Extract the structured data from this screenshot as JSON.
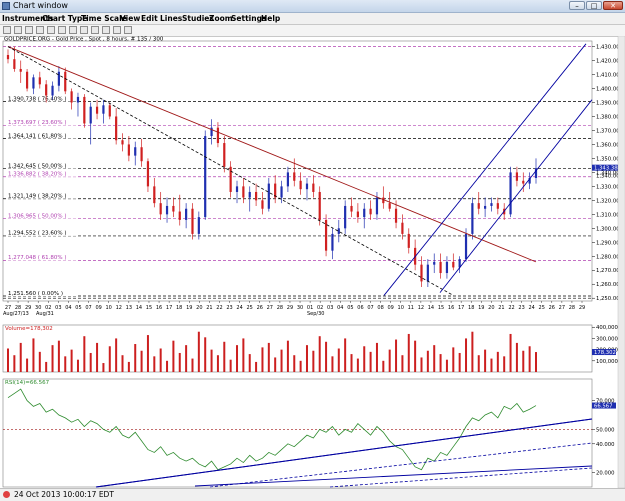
{
  "window": {
    "title": "Chart window",
    "min_glyph": "–",
    "max_glyph": "□",
    "close_glyph": "✕"
  },
  "menu": [
    "Instruments",
    "Chart Type",
    "Time Scale",
    "View",
    "Edit",
    "Lines",
    "Studies",
    "Zoom",
    "Settings",
    "Help"
  ],
  "toolbar": {
    "icons": [
      "open-icon",
      "save-icon",
      "print-icon",
      "cursor-icon",
      "crosshair-icon",
      "line-tool-icon",
      "zoom-in-icon",
      "zoom-out-icon",
      "candle-icon",
      "bar-icon",
      "line-chart-icon",
      "pointer-icon"
    ]
  },
  "chart": {
    "instrument_label": "GOLDPRICE.ORG - Gold Price , Spot , 8 hours, # 135 / 300",
    "price_axis": [
      "1,430.000",
      "1,420.000",
      "1,410.000",
      "1,400.000",
      "1,390.000",
      "1,380.000",
      "1,370.000",
      "1,360.000",
      "1,350.000",
      "1,340.000",
      "1,330.000",
      "1,320.000",
      "1,310.000",
      "1,300.000",
      "1,290.000",
      "1,280.000",
      "1,270.000",
      "1,260.000",
      "1,250.000"
    ],
    "price_min": 1248,
    "price_max": 1434,
    "last_price": "1,343.380",
    "prev_price": "1,340.000",
    "fib_levels": [
      {
        "label": "1,390.738 ( 76.40% )",
        "price": 1390.738,
        "color": "#000000"
      },
      {
        "label": "1,373.697 ( 23.60% )",
        "price": 1373.697,
        "color": "#b040b0"
      },
      {
        "label": "1,364.141 ( 61.80% )",
        "price": 1364.141,
        "color": "#000000"
      },
      {
        "label": "1,342.645 ( 50.00% )",
        "price": 1342.645,
        "color": "#000000"
      },
      {
        "label": "1,336.882 ( 38.20% )",
        "price": 1336.882,
        "color": "#b040b0"
      },
      {
        "label": "1,321.149 ( 38.20% )",
        "price": 1321.149,
        "color": "#000000"
      },
      {
        "label": "1,306.965 ( 50.00% )",
        "price": 1306.965,
        "color": "#b040b0"
      },
      {
        "label": "1,294.552 ( 23.60% )",
        "price": 1294.552,
        "color": "#000000"
      },
      {
        "label": "1,277.048 ( 61.80% )",
        "price": 1277.048,
        "color": "#b040b0"
      },
      {
        "label": "1,251.560 ( 0.00% )",
        "price": 1251.56,
        "color": "#000000"
      }
    ],
    "top_line_price": 1430,
    "bottom_line_price": 1250,
    "date_axis": [
      "27",
      "28",
      "29",
      "30",
      "02",
      "03",
      "04",
      "05",
      "07",
      "09",
      "10",
      "12",
      "13",
      "14",
      "15",
      "16",
      "17",
      "18",
      "19",
      "20",
      "21",
      "22",
      "23",
      "24",
      "25",
      "26",
      "27",
      "28",
      "29",
      "30",
      "01",
      "02",
      "03",
      "04",
      "05",
      "06",
      "07",
      "08",
      "09",
      "10",
      "11",
      "12",
      "14",
      "15",
      "16",
      "17",
      "18",
      "19",
      "20",
      "21",
      "22",
      "23",
      "24",
      "25",
      "26",
      "27",
      "28",
      "29"
    ],
    "month_labels": [
      "Aug/27/13",
      "Aug/31",
      "Sep/30"
    ],
    "candles": [
      [
        1424,
        1428,
        1418,
        1421
      ],
      [
        1421,
        1430,
        1412,
        1414
      ],
      [
        1414,
        1420,
        1404,
        1412
      ],
      [
        1412,
        1414,
        1398,
        1400
      ],
      [
        1400,
        1410,
        1396,
        1408
      ],
      [
        1408,
        1412,
        1400,
        1403
      ],
      [
        1403,
        1406,
        1390,
        1395
      ],
      [
        1395,
        1405,
        1392,
        1402
      ],
      [
        1402,
        1416,
        1398,
        1412
      ],
      [
        1412,
        1415,
        1396,
        1398
      ],
      [
        1398,
        1400,
        1385,
        1390
      ],
      [
        1390,
        1397,
        1380,
        1394
      ],
      [
        1394,
        1396,
        1372,
        1375
      ],
      [
        1375,
        1390,
        1360,
        1387
      ],
      [
        1387,
        1392,
        1378,
        1382
      ],
      [
        1382,
        1392,
        1375,
        1388
      ],
      [
        1388,
        1390,
        1378,
        1380
      ],
      [
        1380,
        1386,
        1360,
        1363
      ],
      [
        1363,
        1368,
        1355,
        1360
      ],
      [
        1360,
        1366,
        1348,
        1352
      ],
      [
        1352,
        1362,
        1345,
        1358
      ],
      [
        1358,
        1364,
        1344,
        1348
      ],
      [
        1348,
        1350,
        1326,
        1330
      ],
      [
        1330,
        1336,
        1315,
        1318
      ],
      [
        1318,
        1326,
        1306,
        1310
      ],
      [
        1310,
        1322,
        1304,
        1316
      ],
      [
        1316,
        1322,
        1308,
        1312
      ],
      [
        1312,
        1324,
        1302,
        1306
      ],
      [
        1306,
        1318,
        1300,
        1314
      ],
      [
        1314,
        1318,
        1292,
        1296
      ],
      [
        1296,
        1312,
        1292,
        1308
      ],
      [
        1308,
        1370,
        1306,
        1366
      ],
      [
        1366,
        1378,
        1360,
        1372
      ],
      [
        1372,
        1376,
        1358,
        1361
      ],
      [
        1361,
        1366,
        1340,
        1344
      ],
      [
        1344,
        1348,
        1322,
        1326
      ],
      [
        1326,
        1334,
        1318,
        1330
      ],
      [
        1330,
        1336,
        1318,
        1322
      ],
      [
        1322,
        1330,
        1312,
        1326
      ],
      [
        1326,
        1332,
        1316,
        1320
      ],
      [
        1320,
        1326,
        1310,
        1314
      ],
      [
        1314,
        1336,
        1312,
        1332
      ],
      [
        1332,
        1338,
        1318,
        1322
      ],
      [
        1322,
        1334,
        1318,
        1330
      ],
      [
        1330,
        1344,
        1326,
        1340
      ],
      [
        1340,
        1350,
        1330,
        1334
      ],
      [
        1334,
        1340,
        1324,
        1328
      ],
      [
        1328,
        1336,
        1320,
        1332
      ],
      [
        1332,
        1338,
        1322,
        1326
      ],
      [
        1326,
        1330,
        1302,
        1306
      ],
      [
        1306,
        1310,
        1280,
        1284
      ],
      [
        1284,
        1300,
        1278,
        1296
      ],
      [
        1296,
        1306,
        1290,
        1300
      ],
      [
        1300,
        1320,
        1296,
        1316
      ],
      [
        1316,
        1322,
        1308,
        1312
      ],
      [
        1312,
        1318,
        1304,
        1308
      ],
      [
        1308,
        1318,
        1300,
        1314
      ],
      [
        1314,
        1320,
        1306,
        1310
      ],
      [
        1310,
        1326,
        1306,
        1322
      ],
      [
        1322,
        1330,
        1314,
        1318
      ],
      [
        1318,
        1326,
        1312,
        1314
      ],
      [
        1314,
        1320,
        1300,
        1304
      ],
      [
        1304,
        1310,
        1292,
        1296
      ],
      [
        1296,
        1300,
        1282,
        1286
      ],
      [
        1286,
        1292,
        1270,
        1274
      ],
      [
        1274,
        1280,
        1258,
        1262
      ],
      [
        1262,
        1278,
        1258,
        1274
      ],
      [
        1274,
        1282,
        1268,
        1276
      ],
      [
        1276,
        1282,
        1264,
        1268
      ],
      [
        1268,
        1280,
        1264,
        1276
      ],
      [
        1276,
        1282,
        1270,
        1272
      ],
      [
        1272,
        1280,
        1268,
        1278
      ],
      [
        1278,
        1300,
        1276,
        1296
      ],
      [
        1296,
        1322,
        1292,
        1318
      ],
      [
        1318,
        1326,
        1310,
        1314
      ],
      [
        1314,
        1322,
        1308,
        1316
      ],
      [
        1316,
        1322,
        1312,
        1318
      ],
      [
        1318,
        1322,
        1310,
        1314
      ],
      [
        1314,
        1318,
        1306,
        1310
      ],
      [
        1310,
        1344,
        1308,
        1340
      ],
      [
        1340,
        1344,
        1330,
        1334
      ],
      [
        1334,
        1340,
        1326,
        1332
      ],
      [
        1332,
        1340,
        1328,
        1336
      ],
      [
        1336,
        1350,
        1332,
        1343
      ]
    ],
    "volume_axis": [
      "400,000",
      "300,000",
      "200,000",
      "100,000"
    ],
    "volume_label": "Volume=178,302",
    "volume_last": "178,302",
    "volume_max": 420000,
    "volumes": [
      210000,
      150000,
      260000,
      120000,
      300000,
      180000,
      90000,
      240000,
      280000,
      140000,
      200000,
      110000,
      320000,
      170000,
      260000,
      80000,
      230000,
      300000,
      150000,
      90000,
      250000,
      190000,
      330000,
      140000,
      210000,
      100000,
      280000,
      170000,
      240000,
      120000,
      360000,
      310000,
      200000,
      150000,
      270000,
      110000,
      240000,
      300000,
      160000,
      90000,
      220000,
      260000,
      130000,
      200000,
      280000,
      150000,
      100000,
      240000,
      190000,
      320000,
      270000,
      140000,
      210000,
      300000,
      160000,
      120000,
      230000,
      180000,
      260000,
      100000,
      200000,
      290000,
      150000,
      340000,
      280000,
      130000,
      190000,
      240000,
      160000,
      110000,
      220000,
      170000,
      300000,
      360000,
      150000,
      200000,
      120000,
      180000,
      140000,
      340000,
      260000,
      190000,
      230000,
      178302
    ],
    "rsi_label": "RSI(14)=66.567",
    "rsi_axis": [
      "70.000",
      "50.000",
      "40.000",
      "20.000"
    ],
    "rsi_last": "66.567",
    "rsi_values": [
      72,
      75,
      78,
      70,
      66,
      68,
      62,
      64,
      60,
      58,
      55,
      57,
      52,
      56,
      54,
      50,
      48,
      52,
      46,
      44,
      48,
      42,
      36,
      34,
      38,
      32,
      34,
      30,
      28,
      30,
      26,
      24,
      28,
      22,
      24,
      26,
      30,
      27,
      32,
      28,
      30,
      34,
      32,
      36,
      40,
      38,
      42,
      46,
      44,
      50,
      48,
      52,
      46,
      50,
      48,
      54,
      50,
      46,
      52,
      48,
      42,
      38,
      36,
      30,
      24,
      22,
      30,
      28,
      34,
      32,
      38,
      44,
      52,
      58,
      56,
      60,
      62,
      58,
      66,
      64,
      68,
      62,
      64,
      66.567
    ],
    "rsi_min": 10,
    "rsi_max": 85
  },
  "status": {
    "text": "24 Oct 2013 10:00:17 EDT"
  },
  "colors": {
    "candle_up": "#1f2fb0",
    "candle_down": "#d02020",
    "volume": "#cc1f1f",
    "rsi_line": "#2e8b2e",
    "trend_red": "#a01818",
    "channel_blue": "#0000a0"
  }
}
